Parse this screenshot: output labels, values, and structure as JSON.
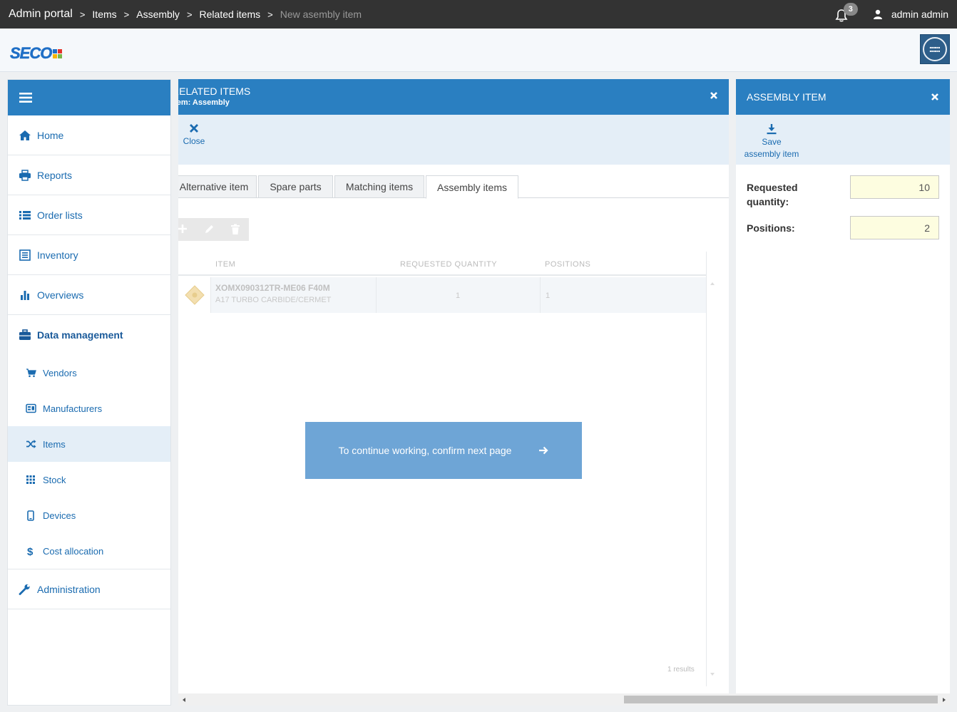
{
  "breadcrumb": {
    "root": "Admin portal",
    "items": [
      "Items",
      "Assembly",
      "Related items"
    ],
    "current": "New asembly item",
    "separator": ">"
  },
  "header": {
    "notifications_count": "3",
    "user_name": "admin admin"
  },
  "brand": {
    "logo_text": "SECO",
    "accent": "#2a7fc1"
  },
  "sidebar": {
    "items": [
      {
        "label": "Home",
        "icon": "home-icon"
      },
      {
        "label": "Reports",
        "icon": "printer-icon"
      },
      {
        "label": "Order lists",
        "icon": "list-icon"
      },
      {
        "label": "Inventory",
        "icon": "inventory-icon"
      },
      {
        "label": "Overviews",
        "icon": "bar-chart-icon"
      }
    ],
    "data_management": {
      "label": "Data management",
      "children": [
        {
          "label": "Vendors",
          "icon": "cart-icon"
        },
        {
          "label": "Manufacturers",
          "icon": "manufacturers-icon"
        },
        {
          "label": "Items",
          "icon": "shuffle-icon"
        },
        {
          "label": "Stock",
          "icon": "grid-icon"
        },
        {
          "label": "Devices",
          "icon": "device-icon"
        },
        {
          "label": "Cost allocation",
          "icon": "dollar-icon"
        }
      ]
    },
    "administration": {
      "label": "Administration",
      "icon": "wrench-icon"
    }
  },
  "related_panel": {
    "title": "RELATED ITEMS",
    "subtitle": "Item: Assembly",
    "close_label": "Close",
    "tabs": [
      "Alternative item",
      "Spare parts",
      "Matching items",
      "Assembly items"
    ],
    "active_tab": "Assembly items",
    "columns": [
      "ITEM",
      "REQUESTED QUANTITY",
      "POSITIONS"
    ],
    "rows": [
      {
        "name": "XOMX090312TR-ME06 F40M",
        "description": "A17 TURBO CARBIDE/CERMET",
        "requested_quantity": "1",
        "positions": "1"
      }
    ],
    "results": "1 results",
    "continue_label": "To continue working, confirm next page"
  },
  "assembly_panel": {
    "title": "ASSEMBLY ITEM",
    "save_label_line1": "Save",
    "save_label_line2": "assembly item",
    "requested_quantity_label_line1": "Requested",
    "requested_quantity_label_line2": "quantity:",
    "requested_quantity_value": "10",
    "positions_label": "Positions:",
    "positions_value": "2"
  }
}
